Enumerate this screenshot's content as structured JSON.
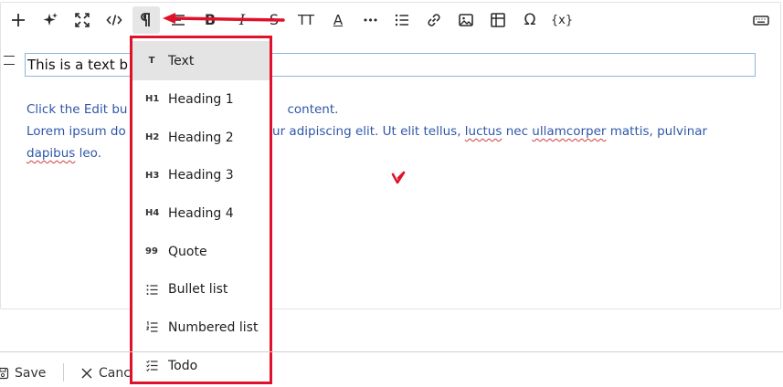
{
  "toolbar": {
    "buttons": [
      {
        "name": "add-icon"
      },
      {
        "name": "ai-sparkle-icon"
      },
      {
        "name": "fullscreen-icon"
      },
      {
        "name": "code-icon"
      },
      {
        "name": "paragraph-icon"
      },
      {
        "name": "align-icon"
      },
      {
        "name": "bold-icon",
        "label": "B"
      },
      {
        "name": "italic-icon",
        "label": "I"
      },
      {
        "name": "strikethrough-icon",
        "label": "S"
      },
      {
        "name": "text-size-icon",
        "label": "TT"
      },
      {
        "name": "font-color-icon",
        "label": "A"
      },
      {
        "name": "more-icon",
        "label": "•••"
      },
      {
        "name": "list-icon"
      },
      {
        "name": "link-icon"
      },
      {
        "name": "image-icon"
      },
      {
        "name": "table-icon"
      },
      {
        "name": "special-char-icon",
        "label": "Ω"
      },
      {
        "name": "variable-icon",
        "label": "{x}"
      },
      {
        "name": "keyboard-icon"
      }
    ]
  },
  "editor": {
    "block_text": "This is a text b",
    "body_line1_part1": "Click the Edit bu",
    "body_line1_part2": "content.",
    "body_line2_part1": "Lorem ipsum do",
    "body_line2_part2": "tur adipiscing elit. Ut elit tellus,",
    "body_line2_spell1": "luctus",
    "body_line2_part3": "nec",
    "body_line2_spell2": "ullamcorper",
    "body_line2_part4": "mattis, pulvinar",
    "body_line3_spell": "dapibus",
    "body_line3_part": "leo."
  },
  "block_type_menu": {
    "items": [
      {
        "icon": "T",
        "label": "Text",
        "selected": true
      },
      {
        "icon": "H1",
        "label": "Heading 1"
      },
      {
        "icon": "H2",
        "label": "Heading 2"
      },
      {
        "icon": "H3",
        "label": "Heading 3"
      },
      {
        "icon": "H4",
        "label": "Heading 4"
      },
      {
        "icon": "99",
        "label": "Quote"
      },
      {
        "icon": "bullet-list-icon",
        "label": "Bullet list"
      },
      {
        "icon": "numbered-list-icon",
        "label": "Numbered list"
      },
      {
        "icon": "todo-list-icon",
        "label": "Todo"
      }
    ]
  },
  "footer": {
    "save_label": "Save",
    "cancel_label": "Canc"
  },
  "colors": {
    "annotation_red": "#e0112b",
    "link_blue": "#2f57a8",
    "selected_bg": "#e4e4e4"
  }
}
